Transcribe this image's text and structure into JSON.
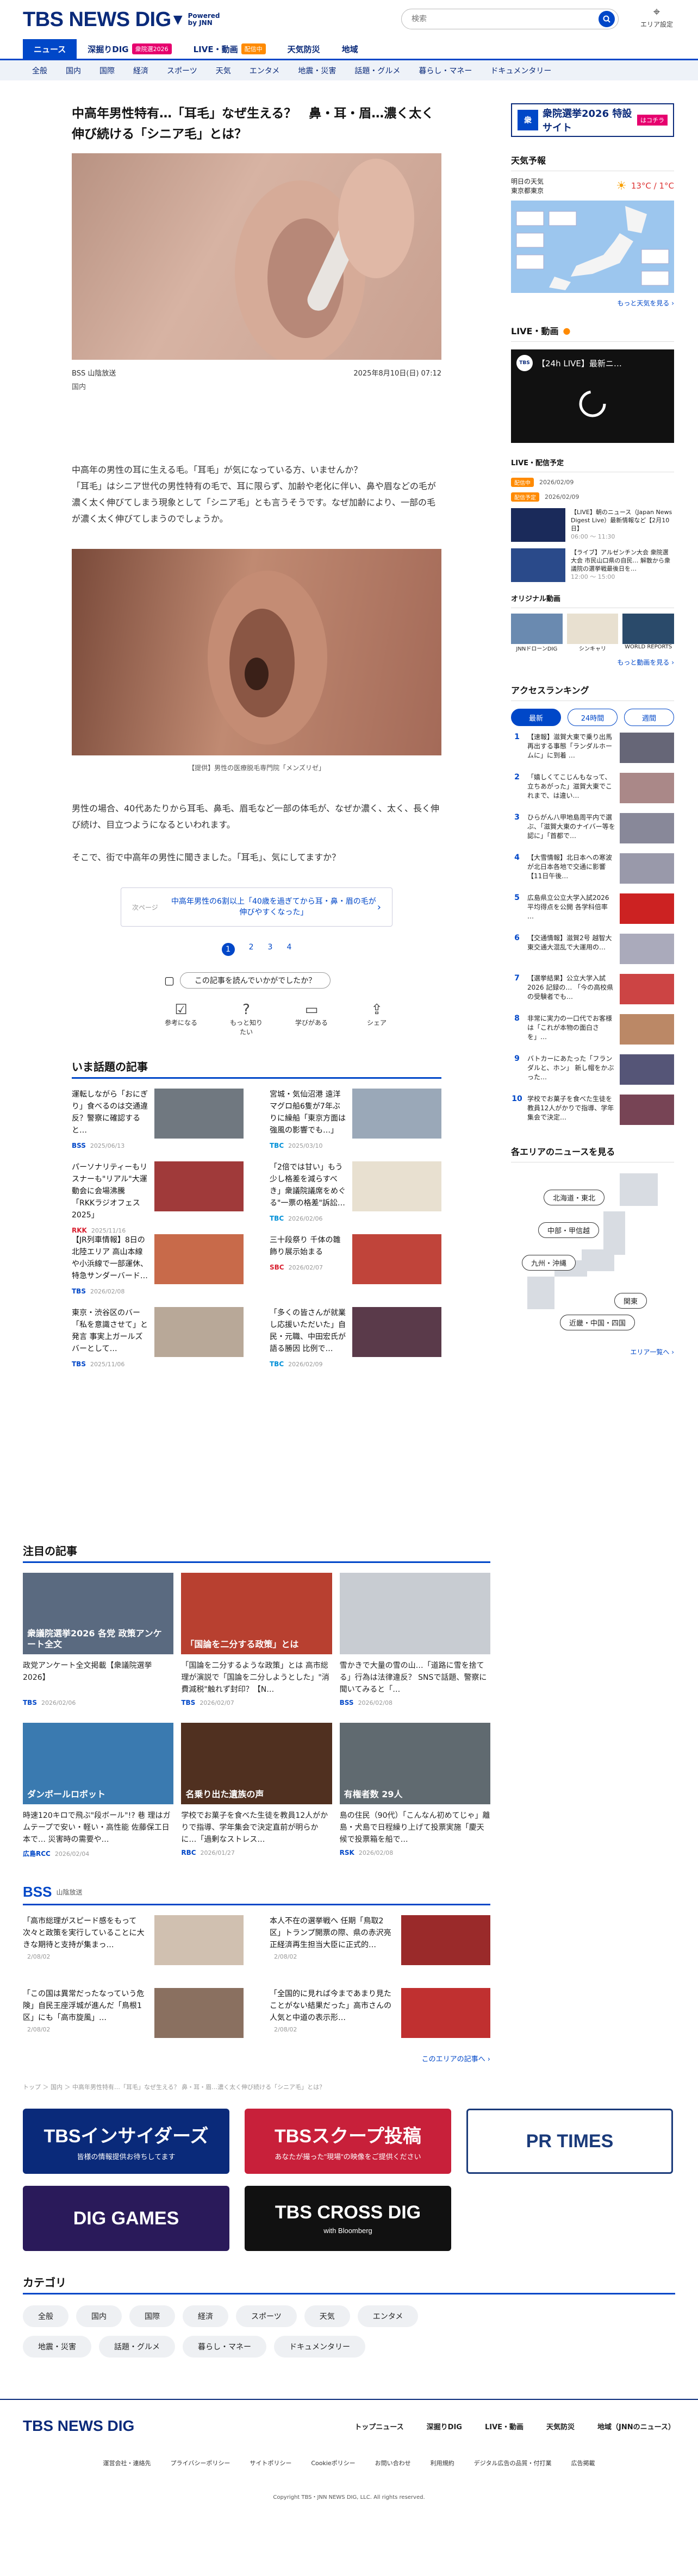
{
  "header": {
    "logo": "TBS NEWS DIG",
    "powered": "Powered\nby JNN",
    "search_placeholder": "検索",
    "area_label": "エリア設定"
  },
  "nav_main": [
    {
      "label": "ニュース",
      "active": true
    },
    {
      "label": "深掘りDIG",
      "badge": "衆院選2026",
      "badge_color": "#e6006e"
    },
    {
      "label": "LIVE・動画",
      "badge": "配信中",
      "badge_color": "#ff8a00"
    },
    {
      "label": "天気防災"
    },
    {
      "label": "地域"
    }
  ],
  "nav_sub": [
    "全般",
    "国内",
    "国際",
    "経済",
    "スポーツ",
    "天気",
    "エンタメ",
    "地震・災害",
    "話題・グルメ",
    "暮らし・マネー",
    "ドキュメンタリー"
  ],
  "article": {
    "title": "中高年男性特有…「耳毛」なぜ生える？　鼻・耳・眉…濃く太く伸び続ける「シニア毛」とは？",
    "source": "BSS 山陰放送",
    "datetime": "2025年8月10日(日) 07:12",
    "category": "国内",
    "p1": "中高年の男性の耳に生える毛。「耳毛」が気になっている方、いませんか？\n「耳毛」はシニア世代の男性特有の毛で、耳に限らず、加齢や老化に伴い、鼻や眉などの毛が濃く太く伸びてしまう現象として「シニア毛」とも言うそうです。なぜ加齢により、一部の毛が濃く太く伸びてしまうのでしょうか。",
    "caption": "【提供】男性の医療脱毛専門院「メンズリゼ」",
    "p2": "男性の場合、40代あたりから耳毛、鼻毛、眉毛など一部の体毛が、なぜか濃く、太く、長く伸び続け、目立つようになるといわれます。",
    "p3": "そこで、街で中高年の男性に聞きました。「耳毛」、気にしてますか？",
    "next_label": "次ページ",
    "next_text": "中高年男性の6割以上「40歳を過ぎてから耳・鼻・眉の毛が伸びやすくなった」",
    "pages": [
      "1",
      "2",
      "3",
      "4"
    ],
    "question": "この記事を読んでいかがでしたか？",
    "reactions": [
      "参考になる",
      "もっと知りたい",
      "学びがある",
      "シェア"
    ]
  },
  "trending": {
    "heading": "いま話題の記事",
    "items": [
      {
        "text": "運転しながら「おにぎり」食べるのは交通違反？警察に確認すると…",
        "src": "BSS",
        "date": "2025/06/13",
        "color": "#0047c8"
      },
      {
        "text": "宮城・気仙沼港 遠洋マグロ船6隻が7年ぶりに繰船「東京方面は強風の影響でも…」",
        "src": "TBC",
        "date": "2025/03/10",
        "color": "#0090d8"
      },
      {
        "text": "パーソナリティーもリスナーも\"リアル\"大運動会に会場沸騰「RKKラジオフェス2025」",
        "src": "RKK",
        "date": "2025/11/16",
        "color": "#d81e2e"
      },
      {
        "text": "「2倍では甘い」もう少し格差を減らすべき」衆議院議席をめぐる\"一票の格差\"訴訟…",
        "src": "TBC",
        "date": "2026/02/06",
        "color": "#0090d8"
      },
      {
        "text": "【JR列車情報】8日の北陸エリア 高山本線や小浜線で一部運休、特急サンダーバード…",
        "src": "TBS",
        "date": "2026/02/08",
        "color": "#0047c8"
      },
      {
        "text": "三十段祭り 千体の雛飾り展示始まる",
        "src": "SBC",
        "date": "2026/02/07",
        "color": "#d81e2e"
      },
      {
        "text": "東京・渋谷区のバー「私を意識させて」と発言 事実上ガールズバーとして…",
        "src": "TBS",
        "date": "2025/11/06",
        "color": "#0047c8"
      },
      {
        "text": "「多くの皆さんが就業し応援いただいた」自民・元職、中田宏氏が語る勝因 比例で…",
        "src": "TBC",
        "date": "2026/02/09",
        "color": "#0090d8"
      }
    ]
  },
  "featured": {
    "heading": "注目の記事",
    "items": [
      {
        "text": "政党アンケート全文掲載【衆議院選挙2026】",
        "src": "TBS",
        "date": "2026/02/06",
        "thumb": "#5a6a80",
        "label": "衆議院選挙2026 各党 政策アンケート全文"
      },
      {
        "text": "「国論を二分するような政策」とは 高市総理が演説で「国論を二分しようとした」\"消費減税\"触れず封印？【N…",
        "src": "TBS",
        "date": "2026/02/07",
        "thumb": "#b84030",
        "label": "「国論を二分する政策」とは"
      },
      {
        "text": "雪かきで大量の雪の山…「道路に雪を捨てる」行為は法律違反？ SNSで話題、警察に聞いてみると「…",
        "src": "BSS",
        "date": "2026/02/08",
        "thumb": "#c8ccd2",
        "label": ""
      },
      {
        "text": "時速120キロで飛ぶ\"段ボール\"!? 巷 理はガムテープで安い・軽い・高性能 佐藤保工日本で… 災害時の需要や…",
        "src": "広島RCC",
        "date": "2026/02/04",
        "thumb": "#3a7ab0",
        "label": "ダンボールロボット"
      },
      {
        "text": "学校でお菓子を食べた生徒を教員12人がかりで指導、学年集会で決定直前が明らかに…「過剰なストレス…",
        "src": "RBC",
        "date": "2026/01/27",
        "thumb": "#503020",
        "label": "名乗り出た遺族の声"
      },
      {
        "text": "島の住民（90代）「こんなん初めてじゃ」離島・犬島で日程繰り上げて投票実施「慶天候で投票箱を船で…",
        "src": "RSK",
        "date": "2026/02/08",
        "thumb": "#606a70",
        "label": "有権者数 29人"
      }
    ]
  },
  "local": {
    "src_logo": "BSS",
    "src_name": "山陰放送",
    "items": [
      {
        "text": "「高市総理がスピード感をもって次々と政策を実行していることに大きな期待と支持が集まっ…",
        "date": "2/08/02"
      },
      {
        "text": "本人不在の選挙戦へ 任期「鳥取2区」トランプ開票の際、県の赤沢亮正経済再生担当大臣に正式的…",
        "date": "2/08/02"
      },
      {
        "text": "「この国は異常だったなっていう危険」自民王座浮城が進んだ「鳥根1区」にも「高市旋風」…",
        "date": "2/08/02"
      },
      {
        "text": "「全国的に見れば今まであまり見たことがない結果だった」高市さんの人気と中道の表示形…",
        "date": "2/08/02"
      }
    ],
    "more": "このエリアの記事へ ›"
  },
  "breadcrumb": "トップ ＞ 国内 ＞ 中高年男性特有…「耳毛」なぜ生える？ 鼻・耳・眉…濃く太く伸び続ける「シニア毛」とは？",
  "banners": [
    {
      "label": "TBSインサイダーズ",
      "sub": "皆様の情報提供お待ちしてます",
      "bg": "#0a2a7a",
      "fg": "#fff"
    },
    {
      "label": "TBSスクープ投稿",
      "sub": "あなたが撮った\"現場\"の映像をご提供ください",
      "bg": "#c8203a",
      "fg": "#fff"
    },
    {
      "label": "PR TIMES",
      "sub": "",
      "bg": "#fff",
      "fg": "#1a3a7a"
    },
    {
      "label": "DIG GAMES",
      "sub": "",
      "bg": "#2a1a5a",
      "fg": "#fff"
    },
    {
      "label": "TBS CROSS DIG",
      "sub": "with Bloomberg",
      "bg": "#111",
      "fg": "#fff"
    }
  ],
  "categories": {
    "heading": "カテゴリ",
    "items": [
      "全般",
      "国内",
      "国際",
      "経済",
      "スポーツ",
      "天気",
      "エンタメ",
      "地震・災害",
      "話題・グルメ",
      "暮らし・マネー",
      "ドキュメンタリー"
    ]
  },
  "footer": {
    "logo": "TBS NEWS DIG",
    "nav": [
      "トップニュース",
      "深掘りDIG",
      "LIVE・動画",
      "天気防災",
      "地域（JNNのニュース）"
    ],
    "links": [
      "運営会社・連絡先",
      "プライバシーポリシー",
      "サイトポリシー",
      "Cookieポリシー",
      "お問い合わせ",
      "利用規約",
      "デジタル広告の品質・付打業",
      "広告掲載"
    ],
    "copyright": "Copyright TBS・JNN NEWS DIG, LLC. All rights reserved."
  },
  "sidebar": {
    "election_banner": "衆院選挙2026 特設サイト",
    "election_link": "はコチラ",
    "weather": {
      "heading": "天気予報",
      "when": "明日の天気",
      "where": "東京都東京",
      "temp": "13°C / 1°C",
      "more": "もっと天気を見る ›"
    },
    "live": {
      "heading": "LIVE・動画",
      "video_title": "【24h LIVE】最新ニ…",
      "sched_heading": "LIVE・配信予定",
      "sched": [
        {
          "tag": "配信中",
          "time": "2026/02/09"
        },
        {
          "tag": "配信予定",
          "time": "2026/02/09"
        }
      ],
      "items": [
        {
          "text": "【LIVE】朝のニュース（Japan News Digest Live）最新情報など【2月10日】",
          "time": "06:00 〜 11:30"
        },
        {
          "text": "【ライブ】アルゼンチン大会 衆院選大会 市民山口県の自民… 解散から衆議院の選挙戦最後日を…",
          "time": "12:00 〜 15:00"
        }
      ],
      "orig_heading": "オリジナル動画",
      "orig": [
        "JNNドローンDIG",
        "シンキャリ",
        "WORLD REPORTS"
      ],
      "more": "もっと動画を見る ›"
    },
    "ranking": {
      "heading": "アクセスランキング",
      "tabs": [
        "最新",
        "24時間",
        "週間"
      ],
      "items": [
        "【速報】滋賀大東で乗り出馬再出する事態「ランダルホームに」に到着 …",
        "「嬉しくてこじんもなって、立ちあがった」滋賀大東でこれまで、は違い…",
        "ひらがん八甲地島周平内で選ぶ、「滋賀大東のナイバー等を認に」「首都で…",
        "【大雪情報】北日本への寒波が北日本各地で交通に影響 【11日午後…",
        "広島県立公立大学入試2026 平均得点を公開 各学科倍率 …",
        "【交通情報】滋賀2号 越智大東交通大混乱で大運用の…",
        "【選挙結果】公立大学入試2026 記録の… 「今の高校県の受験者でも…",
        "非常に実力の一口代でお客様は「これが本物の面白さを」…",
        "バトカーにあたった「フランダルと、ホン」 新し帽をかぶった…",
        "学校でお菓子を食べた生徒を教員12人がかりで指導、学年集会で決定…"
      ]
    },
    "area": {
      "heading": "各エリアのニュースを見る",
      "regions": [
        "北海道・東北",
        "中部・甲信越",
        "九州・沖縄",
        "関東",
        "近畿・中国・四国"
      ],
      "more": "エリア一覧へ ›"
    }
  }
}
